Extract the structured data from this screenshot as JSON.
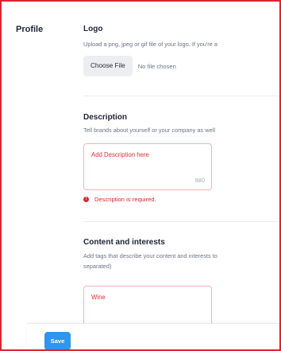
{
  "sidebar": {
    "section_label": "Profile"
  },
  "logo": {
    "title": "Logo",
    "description": "Upload a png, jpeg or gif file of your logo. If you're a",
    "choose_file_label": "Choose File",
    "file_status": "No file chosen"
  },
  "description": {
    "title": "Description",
    "help": "Tell brands about yourself or your company as well",
    "placeholder": "Add Description here",
    "char_count": "980",
    "error_icon": "!",
    "error": "Description is required."
  },
  "content_interests": {
    "title": "Content and interests",
    "help_line1": "Add tags that describe your content and interests to",
    "help_line2": "separated)",
    "value": "Wine"
  },
  "footer": {
    "save_label": "Save"
  },
  "colors": {
    "error": "#d8252f",
    "accent": "#2f95ee",
    "error_border": "#f2b4b6"
  }
}
